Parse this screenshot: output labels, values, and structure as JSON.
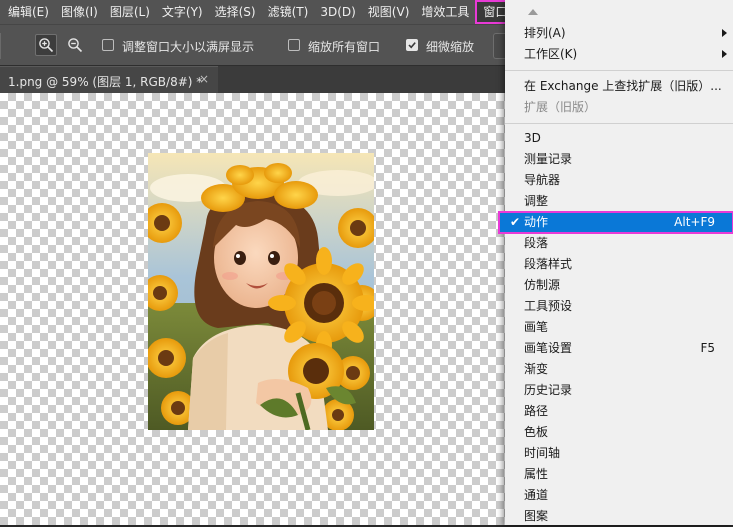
{
  "menubar": {
    "items": [
      "编辑(E)",
      "图像(I)",
      "图层(L)",
      "文字(Y)",
      "选择(S)",
      "滤镜(T)",
      "3D(D)",
      "视图(V)",
      "增效工具",
      "窗口(W)"
    ]
  },
  "options": {
    "resize_windows_label": "调整窗口大小以满屏显示",
    "zoom_all_label": "缩放所有窗口",
    "scrubby_zoom_label": "细微缩放",
    "resize_windows_checked": false,
    "zoom_all_checked": false,
    "scrubby_zoom_checked": true
  },
  "document_tab": {
    "title": "1.png @ 59% (图层 1, RGB/8#) *",
    "close": "×"
  },
  "window_menu": {
    "top_items": [
      {
        "label": "排列(A)",
        "submenu": true
      },
      {
        "label": "工作区(K)",
        "submenu": true
      }
    ],
    "ext_items": [
      {
        "label": "在 Exchange 上查找扩展（旧版）...",
        "disabled": false
      },
      {
        "label": "扩展（旧版）",
        "disabled": true
      }
    ],
    "panel_items": [
      {
        "label": "3D"
      },
      {
        "label": "测量记录"
      },
      {
        "label": "导航器"
      },
      {
        "label": "调整"
      },
      {
        "label": "动作",
        "shortcut": "Alt+F9",
        "checked": true,
        "highlighted": true
      },
      {
        "label": "段落"
      },
      {
        "label": "段落样式"
      },
      {
        "label": "仿制源"
      },
      {
        "label": "工具预设"
      },
      {
        "label": "画笔"
      },
      {
        "label": "画笔设置",
        "shortcut": "F5"
      },
      {
        "label": "渐变"
      },
      {
        "label": "历史记录"
      },
      {
        "label": "路径"
      },
      {
        "label": "色板"
      },
      {
        "label": "时间轴"
      },
      {
        "label": "属性"
      },
      {
        "label": "通道"
      },
      {
        "label": "图案"
      }
    ]
  },
  "colors": {
    "highlight": "#0a78d7",
    "annotation": "#e83ad6"
  }
}
